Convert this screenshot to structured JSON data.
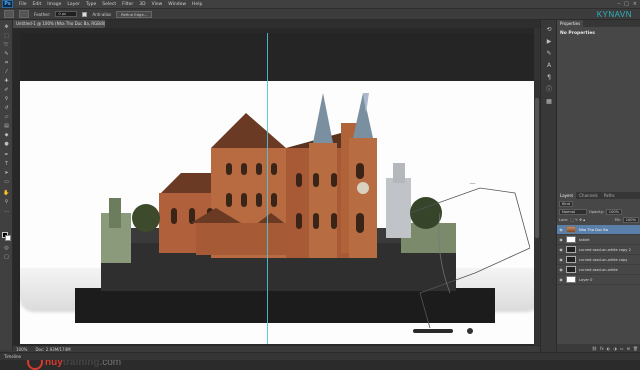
{
  "app": {
    "logo": "Ps",
    "brand": "KYNAVN"
  },
  "menu": [
    "File",
    "Edit",
    "Image",
    "Layer",
    "Type",
    "Select",
    "Filter",
    "3D",
    "View",
    "Window",
    "Help"
  ],
  "window_controls": [
    "–",
    "□",
    "×"
  ],
  "options": {
    "feather_label": "Feather:",
    "feather_value": "0 px",
    "antialias_label": "Anti-alias",
    "refine_button": "Refine Edge..."
  },
  "document": {
    "tab_title": "Untitled-1 @ 100% (Nha Tho Duc Ba, RGB/8) *"
  },
  "status": {
    "zoom": "100%",
    "doc_size": "Doc: 2.93M/174M"
  },
  "timeline_label": "Timeline",
  "watermark": {
    "part1": "huy",
    "part2": "training",
    "part3": ".com"
  },
  "properties": {
    "tab": "Properties",
    "title": "No Properties"
  },
  "layers": {
    "tabs": [
      "Layers",
      "Channels",
      "Paths"
    ],
    "kind": "Kind",
    "blend_mode": "Normal",
    "opacity_label": "Opacity:",
    "opacity_value": "100%",
    "lock_label": "Lock:",
    "fill_label": "Fill:",
    "fill_value": "100%",
    "items": [
      {
        "name": "Nha Tho Duc Ba",
        "selected": true,
        "thumb": "photo"
      },
      {
        "name": "tablet",
        "selected": false,
        "thumb": "white"
      },
      {
        "name": "curved-road-on-white copy 2",
        "selected": false,
        "thumb": "dark"
      },
      {
        "name": "curved-road-on-white copy",
        "selected": false,
        "thumb": "dark"
      },
      {
        "name": "curved-road-on-white",
        "selected": false,
        "thumb": "dark"
      },
      {
        "name": "Layer 0",
        "selected": false,
        "thumb": "white"
      }
    ],
    "footer_icons": [
      "link-icon",
      "fx-icon",
      "mask-icon",
      "adjustment-icon",
      "folder-icon",
      "new-layer-icon",
      "trash-icon"
    ]
  },
  "colors": {
    "accent_guide": "#4ec3d8",
    "selected_layer": "#5a7fa8",
    "brand": "#2ab5c0",
    "watermark_red": "#d73a2a"
  }
}
